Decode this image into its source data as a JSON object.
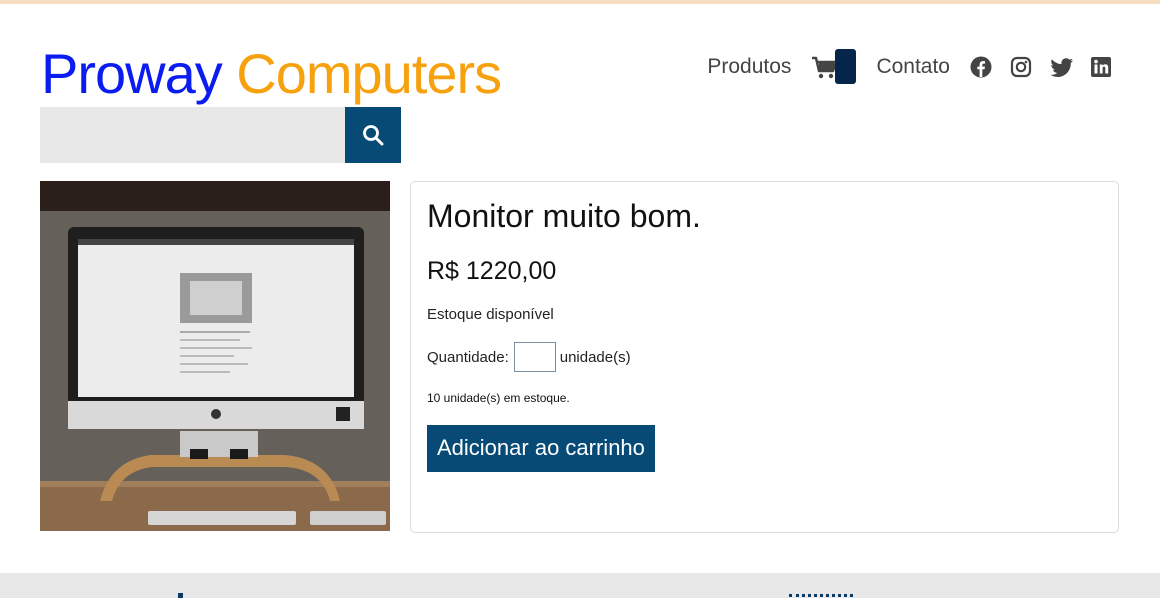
{
  "brand": {
    "part1": "Proway",
    "part2": "Computers",
    "color1": "#0b1cf0",
    "color2": "#f7a10f"
  },
  "nav": {
    "products_label": "Produtos",
    "contact_label": "Contato",
    "cart_icon": "shopping-cart-icon",
    "social": [
      "facebook-icon",
      "instagram-icon",
      "twitter-icon",
      "linkedin-icon"
    ]
  },
  "search": {
    "value": "",
    "placeholder": "",
    "icon": "search-icon",
    "button_color": "#064a75"
  },
  "product": {
    "title": "Monitor muito bom.",
    "price": "R$ 1220,00",
    "availability": "Estoque disponível",
    "quantity_label": "Quantidade:",
    "quantity_value": "",
    "quantity_unit": "unidade(s)",
    "stock_count_text": "10 unidade(s) em estoque.",
    "add_to_cart_label": "Adicionar ao carrinho"
  },
  "colors": {
    "accent": "#064a75",
    "cart_badge": "#06254b"
  }
}
